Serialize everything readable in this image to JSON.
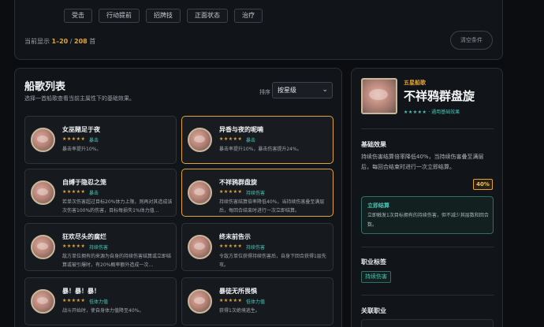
{
  "filters": {
    "chips": [
      "受击",
      "行动提前",
      "招牌技",
      "正面状态",
      "治疗"
    ],
    "count_prefix": "当前显示 ",
    "count_range": "1–20",
    "count_sep": " / ",
    "count_total": "208",
    "count_suffix": " 首",
    "clear_label": "清空条件"
  },
  "list": {
    "title": "船歌列表",
    "subtitle": "选择一首船歌查看当前主属性下的基础效果。",
    "sort_label": "排序",
    "sort_value": "按星级",
    "cards": [
      {
        "name": "女巫赌足于夜",
        "stars": "★★★★★",
        "tag": "暴击",
        "desc": "暴击率提升10%。",
        "highlighted": false
      },
      {
        "name": "异香与夜的呢喃",
        "stars": "★★★★★",
        "tag": "暴击",
        "desc": "暴击率提升10%，暴击伤害提升24%。",
        "highlighted": true
      },
      {
        "name": "自缚于隐忍之笼",
        "stars": "★★★★★",
        "tag": "暴击",
        "desc": "若单次伤害超过目标20%体力上限，则再对其造成该次伤害100%的伤害，目标每损失1%体力值…",
        "highlighted": false
      },
      {
        "name": "不祥鸦群盘旋",
        "stars": "★★★★★",
        "tag": "持续伤害",
        "desc": "持续伤害结算倍率降低40%，当持续伤害叠至满层后，每回合结束时进行一次立即结算。",
        "highlighted": true
      },
      {
        "name": "狂欢尽头的腐烂",
        "stars": "★★★★★",
        "tag": "持续伤害",
        "desc": "敌方单位拥有的来源为自身的持续伤害结算或立即结算或被引爆时，有20%概率额外造成一次…",
        "highlighted": false
      },
      {
        "name": "终末前告示",
        "stars": "★★★★★",
        "tag": "持续伤害",
        "desc": "令敌方单位获得持续伤害后，自身下回合获得1层先攻。",
        "highlighted": false
      },
      {
        "name": "暴！暴！暴！",
        "stars": "★★★★★",
        "tag": "低体力值",
        "desc": "战斗开始时，使自身体力值降至40%。",
        "highlighted": false
      },
      {
        "name": "暴徒无所畏惧",
        "stars": "★★★★★",
        "tag": "低体力值",
        "desc": "获得1次绝境逃生。",
        "highlighted": false
      }
    ]
  },
  "detail": {
    "rarity": "五星船歌",
    "name": "不祥鸦群盘旋",
    "stars": "★★★★★",
    "stars_note": " · 通用基础效果",
    "base_title": "基础效果",
    "base_desc": "持续伤害结算倍率降低40%，当持续伤害叠至满层后，每回合结束时进行一次立即结算。",
    "percent": "40%",
    "effect_title": "立即结算",
    "effect_desc": "立即触发1次目标拥有的持续伤害，但不减少其层数和回合数。",
    "tags_title": "职业标签",
    "job_tag": "持续伤害",
    "jobs_title": "关联职业"
  },
  "colors": {
    "accent": "#e0a43a",
    "teal": "#49c4b6",
    "background": "#0b0d10",
    "panel": "#111418"
  }
}
